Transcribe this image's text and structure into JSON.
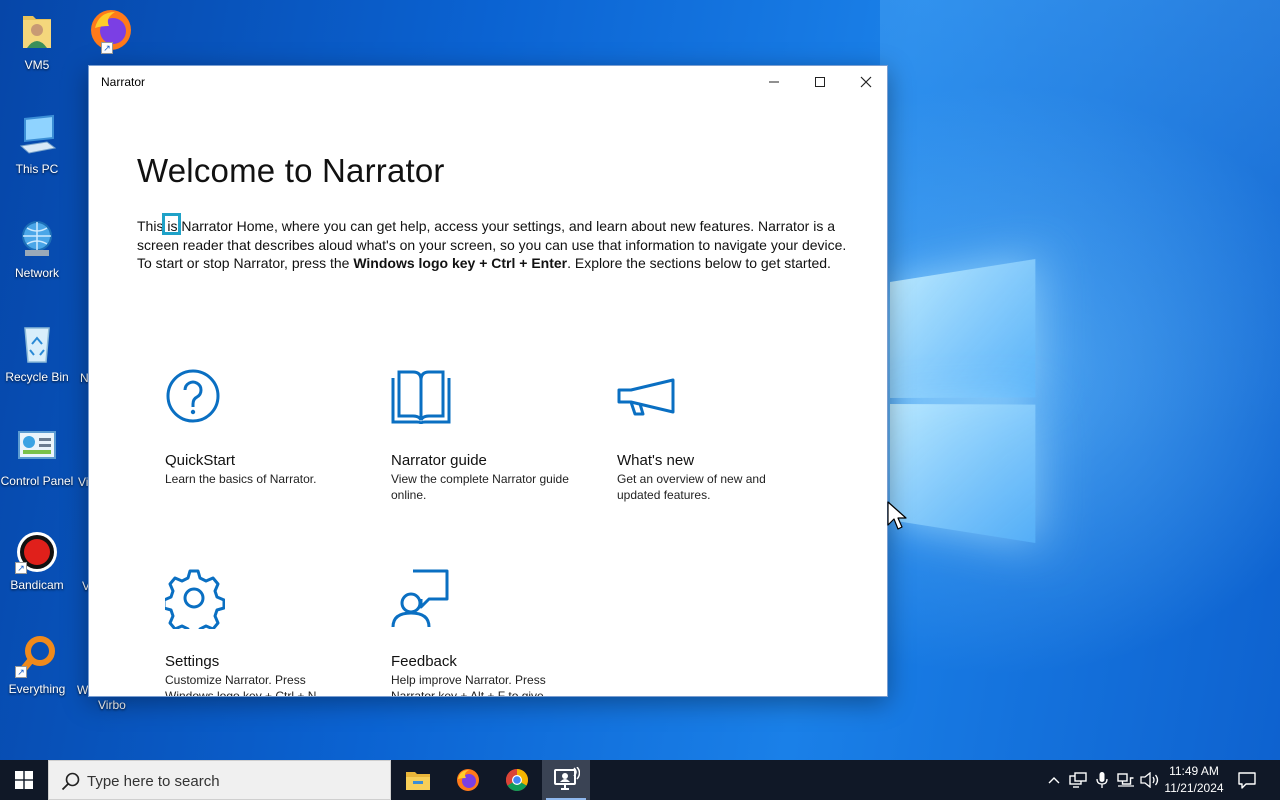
{
  "desktop": {
    "icons": [
      {
        "label": "VM5"
      },
      {
        "label": "Firefox"
      },
      {
        "label": "This PC"
      },
      {
        "label": "Network"
      },
      {
        "label": "Recycle Bin"
      },
      {
        "label": "Control Panel"
      },
      {
        "label": "Bandicam"
      },
      {
        "label": "Everything"
      },
      {
        "label": "Virbo"
      }
    ]
  },
  "window": {
    "title": "Narrator",
    "heading": "Welcome to Narrator",
    "intro": {
      "part1": "This ",
      "focused_word": "is",
      "part2": " Narrator Home, where you can get help, access your settings, and learn about new features. Narrator is a screen reader that describes aloud what's on your screen, so you can use that information to navigate your device. To start or stop Narrator, press the ",
      "shortcut": "Windows logo key + Ctrl + Enter",
      "part3": ". Explore the sections below to get started."
    },
    "tiles": [
      {
        "title": "QuickStart",
        "desc": "Learn the basics of Narrator."
      },
      {
        "title": "Narrator guide",
        "desc": "View the complete Narrator guide online."
      },
      {
        "title": "What's new",
        "desc": "Get an overview of new and updated features."
      },
      {
        "title": "Settings",
        "desc": "Customize Narrator. Press Windows logo key + Ctrl + N"
      },
      {
        "title": "Feedback",
        "desc": "Help improve Narrator. Press Narrator key + Alt + F to give"
      }
    ],
    "accent_color": "#0a6fc2",
    "focus_color": "#1fa2c8"
  },
  "taskbar": {
    "search_placeholder": "Type here to search",
    "time": "11:49 AM",
    "date": "11/21/2024"
  }
}
